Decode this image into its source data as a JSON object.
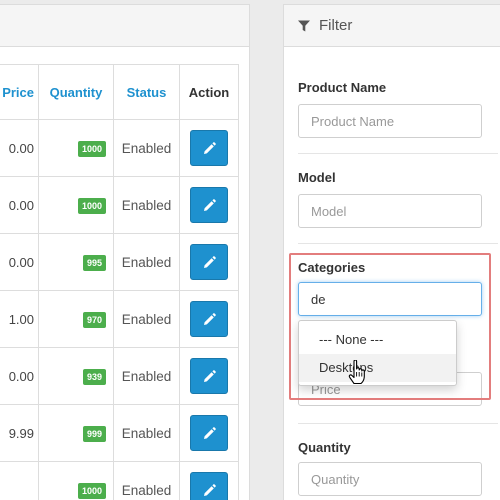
{
  "table": {
    "headers": {
      "price": "Price",
      "quantity": "Quantity",
      "status": "Status",
      "action": "Action"
    },
    "rows": [
      {
        "price": "0.00",
        "quantity": "1000",
        "status": "Enabled"
      },
      {
        "price": "0.00",
        "quantity": "1000",
        "status": "Enabled"
      },
      {
        "price": "0.00",
        "quantity": "995",
        "status": "Enabled"
      },
      {
        "price": "1.00",
        "quantity": "970",
        "status": "Enabled"
      },
      {
        "price": "0.00",
        "quantity": "939",
        "status": "Enabled"
      },
      {
        "price": "9.99",
        "quantity": "999",
        "status": "Enabled"
      },
      {
        "price": "",
        "quantity": "1000",
        "status": "Enabled"
      }
    ],
    "edit_icon": "pencil-icon",
    "badge_color": "#4cae4c",
    "button_color": "#1e91cf"
  },
  "filter": {
    "title": "Filter",
    "icon": "funnel-icon",
    "product_name": {
      "label": "Product Name",
      "placeholder": "Product Name"
    },
    "model": {
      "label": "Model",
      "placeholder": "Model"
    },
    "categories": {
      "label": "Categories",
      "value": "de"
    },
    "price": {
      "placeholder": "Price"
    },
    "quantity": {
      "label": "Quantity",
      "placeholder": "Quantity"
    }
  },
  "dropdown": {
    "options": [
      "--- None ---",
      "Desktops"
    ],
    "hovered": "Desktops"
  },
  "highlight_color": "#e37d7d"
}
